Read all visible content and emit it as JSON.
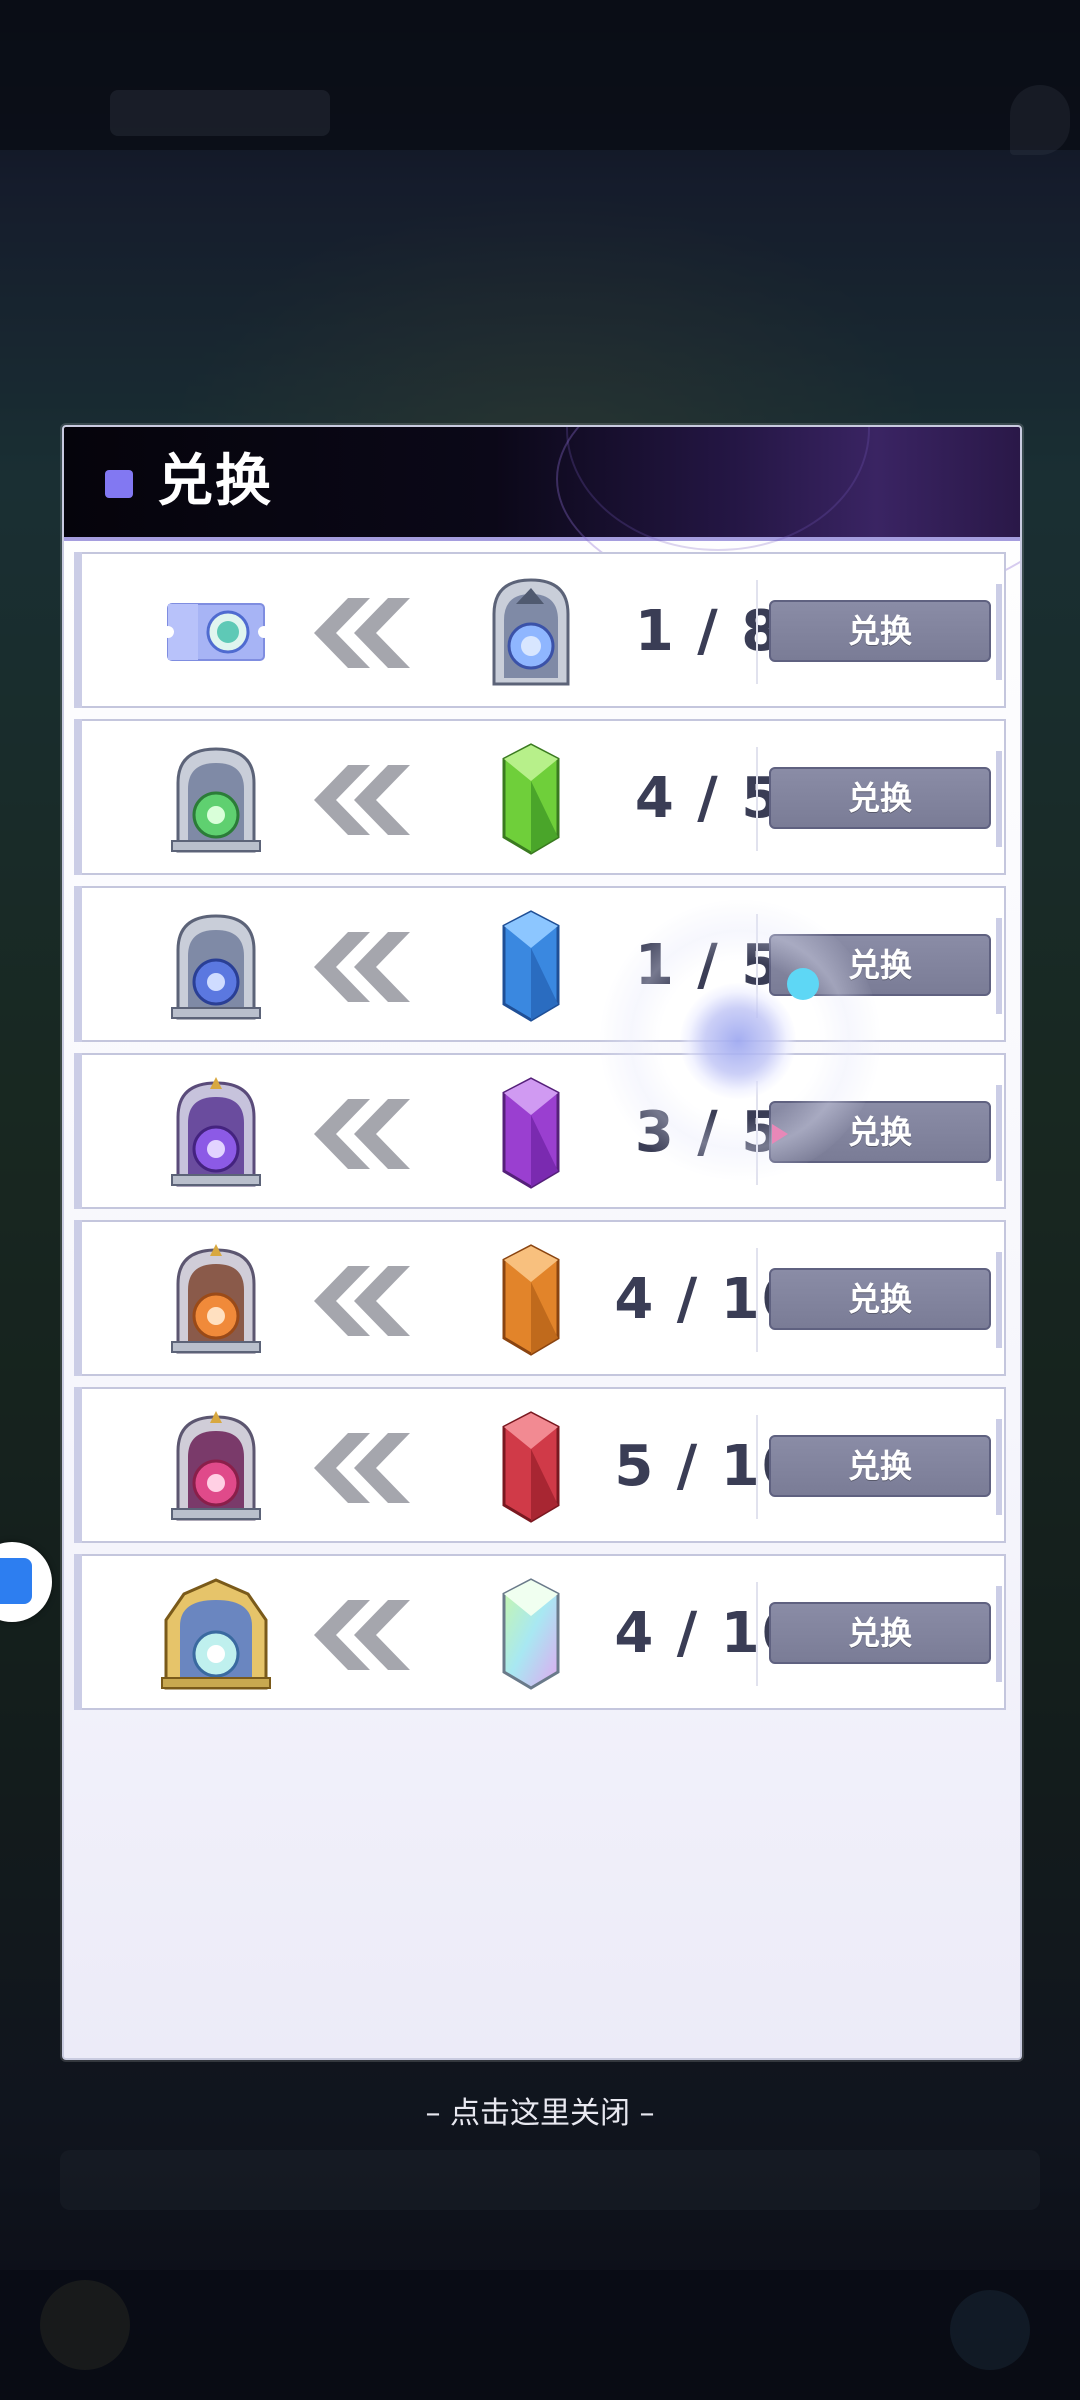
{
  "dialog": {
    "title": "兑换",
    "accent_color": "#8278f2"
  },
  "rows": [
    {
      "source_icon": "ticket-icon",
      "target_icon": "silver-portal-blue-icon",
      "count": "1 / 8",
      "button_label": "兑换",
      "crystal_color": "#6a82d8"
    },
    {
      "source_icon": "silver-portal-green-icon",
      "target_icon": "green-crystal-icon",
      "count": "4 / 5",
      "button_label": "兑换",
      "crystal_color": "#6fcf3a"
    },
    {
      "source_icon": "silver-portal-blue-icon",
      "target_icon": "blue-crystal-icon",
      "count": "1 / 5",
      "button_label": "兑换",
      "crystal_color": "#3a88e0"
    },
    {
      "source_icon": "purple-portal-icon",
      "target_icon": "purple-crystal-icon",
      "count": "3 / 5",
      "button_label": "兑换",
      "crystal_color": "#9a3fd0"
    },
    {
      "source_icon": "orange-portal-icon",
      "target_icon": "orange-crystal-icon",
      "count": "4 / 10",
      "button_label": "兑换",
      "crystal_color": "#e2842a"
    },
    {
      "source_icon": "red-portal-icon",
      "target_icon": "red-crystal-icon",
      "count": "5 / 10",
      "button_label": "兑换",
      "crystal_color": "#d03a48"
    },
    {
      "source_icon": "gold-portal-icon",
      "target_icon": "rainbow-crystal-icon",
      "count": "4 / 10",
      "button_label": "兑换",
      "crystal_color": "#b8f0dc"
    }
  ],
  "close_hint": "– 点击这里关闭 –"
}
